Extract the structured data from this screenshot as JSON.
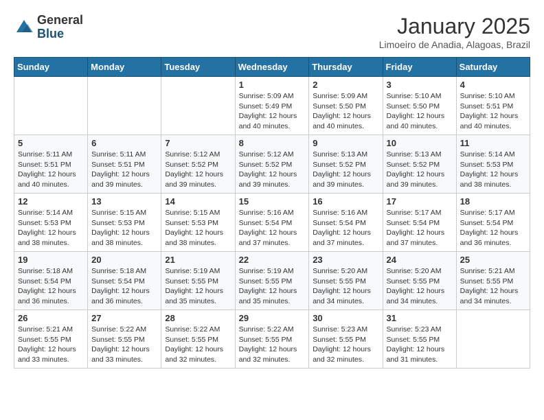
{
  "header": {
    "logo_general": "General",
    "logo_blue": "Blue",
    "month_title": "January 2025",
    "subtitle": "Limoeiro de Anadia, Alagoas, Brazil"
  },
  "weekdays": [
    "Sunday",
    "Monday",
    "Tuesday",
    "Wednesday",
    "Thursday",
    "Friday",
    "Saturday"
  ],
  "weeks": [
    [
      {
        "day": "",
        "info": ""
      },
      {
        "day": "",
        "info": ""
      },
      {
        "day": "",
        "info": ""
      },
      {
        "day": "1",
        "info": "Sunrise: 5:09 AM\nSunset: 5:49 PM\nDaylight: 12 hours\nand 40 minutes."
      },
      {
        "day": "2",
        "info": "Sunrise: 5:09 AM\nSunset: 5:50 PM\nDaylight: 12 hours\nand 40 minutes."
      },
      {
        "day": "3",
        "info": "Sunrise: 5:10 AM\nSunset: 5:50 PM\nDaylight: 12 hours\nand 40 minutes."
      },
      {
        "day": "4",
        "info": "Sunrise: 5:10 AM\nSunset: 5:51 PM\nDaylight: 12 hours\nand 40 minutes."
      }
    ],
    [
      {
        "day": "5",
        "info": "Sunrise: 5:11 AM\nSunset: 5:51 PM\nDaylight: 12 hours\nand 40 minutes."
      },
      {
        "day": "6",
        "info": "Sunrise: 5:11 AM\nSunset: 5:51 PM\nDaylight: 12 hours\nand 39 minutes."
      },
      {
        "day": "7",
        "info": "Sunrise: 5:12 AM\nSunset: 5:52 PM\nDaylight: 12 hours\nand 39 minutes."
      },
      {
        "day": "8",
        "info": "Sunrise: 5:12 AM\nSunset: 5:52 PM\nDaylight: 12 hours\nand 39 minutes."
      },
      {
        "day": "9",
        "info": "Sunrise: 5:13 AM\nSunset: 5:52 PM\nDaylight: 12 hours\nand 39 minutes."
      },
      {
        "day": "10",
        "info": "Sunrise: 5:13 AM\nSunset: 5:52 PM\nDaylight: 12 hours\nand 39 minutes."
      },
      {
        "day": "11",
        "info": "Sunrise: 5:14 AM\nSunset: 5:53 PM\nDaylight: 12 hours\nand 38 minutes."
      }
    ],
    [
      {
        "day": "12",
        "info": "Sunrise: 5:14 AM\nSunset: 5:53 PM\nDaylight: 12 hours\nand 38 minutes."
      },
      {
        "day": "13",
        "info": "Sunrise: 5:15 AM\nSunset: 5:53 PM\nDaylight: 12 hours\nand 38 minutes."
      },
      {
        "day": "14",
        "info": "Sunrise: 5:15 AM\nSunset: 5:53 PM\nDaylight: 12 hours\nand 38 minutes."
      },
      {
        "day": "15",
        "info": "Sunrise: 5:16 AM\nSunset: 5:54 PM\nDaylight: 12 hours\nand 37 minutes."
      },
      {
        "day": "16",
        "info": "Sunrise: 5:16 AM\nSunset: 5:54 PM\nDaylight: 12 hours\nand 37 minutes."
      },
      {
        "day": "17",
        "info": "Sunrise: 5:17 AM\nSunset: 5:54 PM\nDaylight: 12 hours\nand 37 minutes."
      },
      {
        "day": "18",
        "info": "Sunrise: 5:17 AM\nSunset: 5:54 PM\nDaylight: 12 hours\nand 36 minutes."
      }
    ],
    [
      {
        "day": "19",
        "info": "Sunrise: 5:18 AM\nSunset: 5:54 PM\nDaylight: 12 hours\nand 36 minutes."
      },
      {
        "day": "20",
        "info": "Sunrise: 5:18 AM\nSunset: 5:54 PM\nDaylight: 12 hours\nand 36 minutes."
      },
      {
        "day": "21",
        "info": "Sunrise: 5:19 AM\nSunset: 5:55 PM\nDaylight: 12 hours\nand 35 minutes."
      },
      {
        "day": "22",
        "info": "Sunrise: 5:19 AM\nSunset: 5:55 PM\nDaylight: 12 hours\nand 35 minutes."
      },
      {
        "day": "23",
        "info": "Sunrise: 5:20 AM\nSunset: 5:55 PM\nDaylight: 12 hours\nand 34 minutes."
      },
      {
        "day": "24",
        "info": "Sunrise: 5:20 AM\nSunset: 5:55 PM\nDaylight: 12 hours\nand 34 minutes."
      },
      {
        "day": "25",
        "info": "Sunrise: 5:21 AM\nSunset: 5:55 PM\nDaylight: 12 hours\nand 34 minutes."
      }
    ],
    [
      {
        "day": "26",
        "info": "Sunrise: 5:21 AM\nSunset: 5:55 PM\nDaylight: 12 hours\nand 33 minutes."
      },
      {
        "day": "27",
        "info": "Sunrise: 5:22 AM\nSunset: 5:55 PM\nDaylight: 12 hours\nand 33 minutes."
      },
      {
        "day": "28",
        "info": "Sunrise: 5:22 AM\nSunset: 5:55 PM\nDaylight: 12 hours\nand 32 minutes."
      },
      {
        "day": "29",
        "info": "Sunrise: 5:22 AM\nSunset: 5:55 PM\nDaylight: 12 hours\nand 32 minutes."
      },
      {
        "day": "30",
        "info": "Sunrise: 5:23 AM\nSunset: 5:55 PM\nDaylight: 12 hours\nand 32 minutes."
      },
      {
        "day": "31",
        "info": "Sunrise: 5:23 AM\nSunset: 5:55 PM\nDaylight: 12 hours\nand 31 minutes."
      },
      {
        "day": "",
        "info": ""
      }
    ]
  ]
}
